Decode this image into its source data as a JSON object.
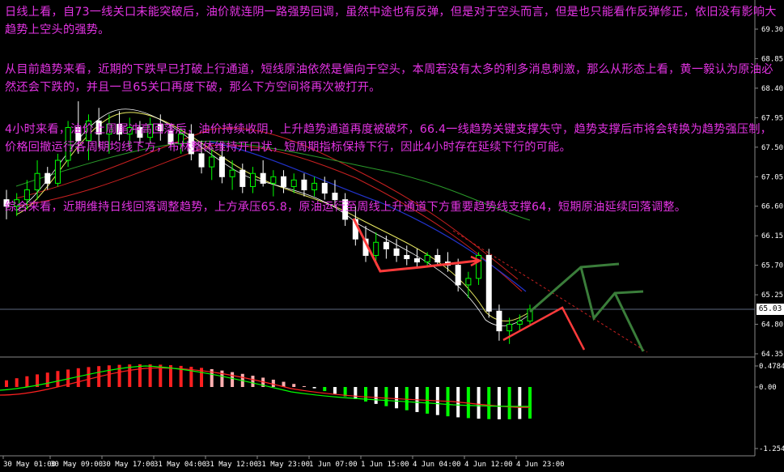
{
  "annotations": [
    "日线上看，自73一线关口未能突破后，油价就连阴一路强势回调，虽然中途也有反弹，但是对于空头而言，但是也只能看作反弹修正，依旧没有影响大趋势上空头的强势。",
    "从目前趋势来看，近期的下跌早已打破上行通道，短线原油依然是偏向于空头，本周若没有太多的利多消息刺激，那么从形态上看，黄一毅认为原油必然还会下跌的，并且一旦65关口再度下破，那么下方空间将再次被打开。",
    "4小时来看，油价上周尾冲高回落后，油价持续收阴，上升趋势通道再度被破坏，66.4一线趋势关键支撑失守，趋势支撑后市将会转换为趋势强压制，价格回撤运行各周期均线下方，布林整体维持开口状，短周期指标保持下行，因此4小时存在延续下行的可能。",
    "综合来看，近期维持日线回落调整趋势，上方承压65.8，原油运行至周线上升通道下方重要趋势线支撑64，短期原油延续回落调整。"
  ],
  "price_axis": [
    "69.30",
    "68.85",
    "68.40",
    "67.95",
    "67.50",
    "67.05",
    "66.60",
    "66.15",
    "65.70",
    "65.25",
    "64.80",
    "64.35"
  ],
  "current_price": "65.03",
  "macd_axis": [
    "0.4784",
    "0.00",
    "-1.2545"
  ],
  "time_axis": [
    "30 May 01:00",
    "30 May 09:00",
    "30 May 17:00",
    "31 May 04:00",
    "31 May 12:00",
    "31 May 23:00",
    "1 Jun 07:00",
    "1 Jun 15:00",
    "4 Jun 04:00",
    "4 Jun 12:00",
    "4 Jun 23:00"
  ],
  "colors": {
    "bull": "#00ff00",
    "bear": "#ffffff",
    "up_arrow": "#3a7d3a",
    "down_arrow": "#ff3b3b",
    "text": "#e233e2"
  },
  "chart_data": {
    "type": "candlestick",
    "price_range": [
      64.35,
      69.3
    ],
    "candles": [
      [
        66.7,
        66.85,
        66.4,
        66.6
      ],
      [
        66.6,
        66.8,
        66.45,
        66.7
      ],
      [
        66.7,
        67.0,
        66.55,
        66.85
      ],
      [
        66.85,
        67.3,
        66.7,
        67.1
      ],
      [
        67.1,
        67.2,
        66.85,
        66.95
      ],
      [
        66.95,
        67.4,
        66.9,
        67.3
      ],
      [
        67.3,
        67.9,
        67.2,
        67.8
      ],
      [
        67.8,
        68.2,
        67.4,
        67.6
      ],
      [
        67.6,
        68.0,
        67.3,
        67.9
      ],
      [
        67.9,
        68.1,
        67.5,
        67.7
      ],
      [
        67.7,
        68.0,
        67.4,
        67.85
      ],
      [
        67.85,
        68.05,
        67.6,
        67.7
      ],
      [
        67.7,
        67.95,
        67.5,
        67.8
      ],
      [
        67.8,
        67.9,
        67.55,
        67.65
      ],
      [
        67.65,
        67.95,
        67.55,
        67.85
      ],
      [
        67.85,
        68.0,
        67.6,
        67.75
      ],
      [
        67.75,
        67.85,
        67.45,
        67.55
      ],
      [
        67.55,
        67.8,
        67.4,
        67.7
      ],
      [
        67.7,
        67.85,
        67.3,
        67.4
      ],
      [
        67.4,
        67.6,
        67.1,
        67.2
      ],
      [
        67.2,
        67.5,
        67.0,
        67.35
      ],
      [
        67.35,
        67.55,
        66.95,
        67.05
      ],
      [
        67.05,
        67.3,
        66.85,
        67.15
      ],
      [
        67.15,
        67.25,
        66.8,
        66.9
      ],
      [
        66.9,
        67.2,
        66.8,
        67.1
      ],
      [
        67.1,
        67.3,
        66.9,
        66.95
      ],
      [
        66.95,
        67.15,
        66.75,
        67.05
      ],
      [
        67.05,
        67.15,
        66.8,
        66.9
      ],
      [
        66.9,
        67.1,
        66.8,
        67.0
      ],
      [
        67.0,
        67.1,
        66.75,
        66.85
      ],
      [
        66.85,
        67.05,
        66.75,
        66.95
      ],
      [
        66.95,
        67.05,
        66.7,
        66.8
      ],
      [
        66.8,
        67.0,
        66.6,
        66.7
      ],
      [
        66.7,
        66.8,
        66.3,
        66.4
      ],
      [
        66.4,
        66.6,
        66.0,
        66.1
      ],
      [
        66.1,
        66.3,
        65.75,
        65.85
      ],
      [
        65.85,
        66.2,
        65.7,
        66.05
      ],
      [
        66.05,
        66.15,
        65.8,
        65.95
      ],
      [
        65.95,
        66.1,
        65.75,
        65.85
      ],
      [
        65.85,
        66.0,
        65.7,
        65.8
      ],
      [
        65.8,
        65.95,
        65.65,
        65.75
      ],
      [
        65.75,
        65.9,
        65.7,
        65.85
      ],
      [
        65.85,
        65.95,
        65.7,
        65.75
      ],
      [
        65.75,
        65.9,
        65.6,
        65.7
      ],
      [
        65.7,
        65.8,
        65.3,
        65.4
      ],
      [
        65.4,
        65.6,
        65.2,
        65.5
      ],
      [
        65.5,
        65.9,
        65.4,
        65.85
      ],
      [
        65.85,
        65.95,
        64.9,
        65.0
      ],
      [
        65.0,
        65.1,
        64.55,
        64.7
      ],
      [
        64.7,
        64.9,
        64.5,
        64.8
      ],
      [
        64.8,
        64.95,
        64.7,
        64.85
      ],
      [
        64.85,
        65.1,
        64.8,
        65.03
      ]
    ]
  }
}
